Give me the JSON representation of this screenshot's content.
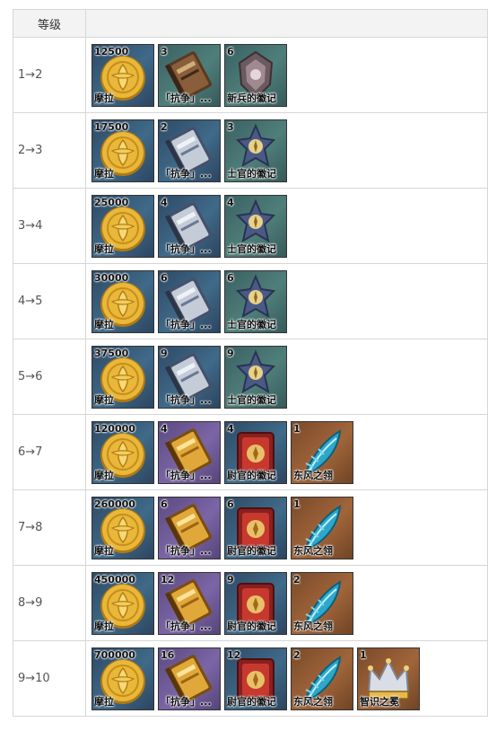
{
  "table": {
    "header_level": "等级",
    "header_items": "",
    "rows": [
      {
        "level": "1→2",
        "items": [
          {
            "icon": "mora-coin-icon",
            "bg": "blue",
            "count": "12500",
            "name": "摩拉"
          },
          {
            "icon": "book-brown-icon",
            "bg": "teal",
            "count": "3",
            "name": "「抗争」..."
          },
          {
            "icon": "insignia-recruit-icon",
            "bg": "teal",
            "count": "6",
            "name": "新兵的徽记"
          }
        ]
      },
      {
        "level": "2→3",
        "items": [
          {
            "icon": "mora-coin-icon",
            "bg": "blue",
            "count": "17500",
            "name": "摩拉"
          },
          {
            "icon": "book-silver-icon",
            "bg": "blue",
            "count": "2",
            "name": "「抗争」..."
          },
          {
            "icon": "insignia-sergeant-icon",
            "bg": "teal",
            "count": "3",
            "name": "士官的徽记"
          }
        ]
      },
      {
        "level": "3→4",
        "items": [
          {
            "icon": "mora-coin-icon",
            "bg": "blue",
            "count": "25000",
            "name": "摩拉"
          },
          {
            "icon": "book-silver-icon",
            "bg": "blue",
            "count": "4",
            "name": "「抗争」..."
          },
          {
            "icon": "insignia-sergeant-icon",
            "bg": "teal",
            "count": "4",
            "name": "士官的徽记"
          }
        ]
      },
      {
        "level": "4→5",
        "items": [
          {
            "icon": "mora-coin-icon",
            "bg": "blue",
            "count": "30000",
            "name": "摩拉"
          },
          {
            "icon": "book-silver-icon",
            "bg": "blue",
            "count": "6",
            "name": "「抗争」..."
          },
          {
            "icon": "insignia-sergeant-icon",
            "bg": "teal",
            "count": "6",
            "name": "士官的徽记"
          }
        ]
      },
      {
        "level": "5→6",
        "items": [
          {
            "icon": "mora-coin-icon",
            "bg": "blue",
            "count": "37500",
            "name": "摩拉"
          },
          {
            "icon": "book-silver-icon",
            "bg": "blue",
            "count": "9",
            "name": "「抗争」..."
          },
          {
            "icon": "insignia-sergeant-icon",
            "bg": "teal",
            "count": "9",
            "name": "士官的徽记"
          }
        ]
      },
      {
        "level": "6→7",
        "items": [
          {
            "icon": "mora-coin-icon",
            "bg": "blue",
            "count": "120000",
            "name": "摩拉"
          },
          {
            "icon": "book-gold-icon",
            "bg": "purple",
            "count": "4",
            "name": "「抗争」..."
          },
          {
            "icon": "insignia-lieutenant-icon",
            "bg": "blue",
            "count": "4",
            "name": "尉官的徽记"
          },
          {
            "icon": "dvalin-plume-icon",
            "bg": "orange",
            "count": "1",
            "name": "东风之翎"
          }
        ]
      },
      {
        "level": "7→8",
        "items": [
          {
            "icon": "mora-coin-icon",
            "bg": "blue",
            "count": "260000",
            "name": "摩拉"
          },
          {
            "icon": "book-gold-icon",
            "bg": "purple",
            "count": "6",
            "name": "「抗争」..."
          },
          {
            "icon": "insignia-lieutenant-icon",
            "bg": "blue",
            "count": "6",
            "name": "尉官的徽记"
          },
          {
            "icon": "dvalin-plume-icon",
            "bg": "orange",
            "count": "1",
            "name": "东风之翎"
          }
        ]
      },
      {
        "level": "8→9",
        "items": [
          {
            "icon": "mora-coin-icon",
            "bg": "blue",
            "count": "450000",
            "name": "摩拉"
          },
          {
            "icon": "book-gold-icon",
            "bg": "purple",
            "count": "12",
            "name": "「抗争」..."
          },
          {
            "icon": "insignia-lieutenant-icon",
            "bg": "blue",
            "count": "9",
            "name": "尉官的徽记"
          },
          {
            "icon": "dvalin-plume-icon",
            "bg": "orange",
            "count": "2",
            "name": "东风之翎"
          }
        ]
      },
      {
        "level": "9→10",
        "items": [
          {
            "icon": "mora-coin-icon",
            "bg": "blue",
            "count": "700000",
            "name": "摩拉"
          },
          {
            "icon": "book-gold-icon",
            "bg": "purple",
            "count": "16",
            "name": "「抗争」..."
          },
          {
            "icon": "insignia-lieutenant-icon",
            "bg": "blue",
            "count": "12",
            "name": "尉官的徽记"
          },
          {
            "icon": "dvalin-plume-icon",
            "bg": "orange",
            "count": "2",
            "name": "东风之翎"
          },
          {
            "icon": "crown-of-insight-icon",
            "bg": "orange",
            "count": "1",
            "name": "智识之冕"
          }
        ]
      }
    ]
  }
}
